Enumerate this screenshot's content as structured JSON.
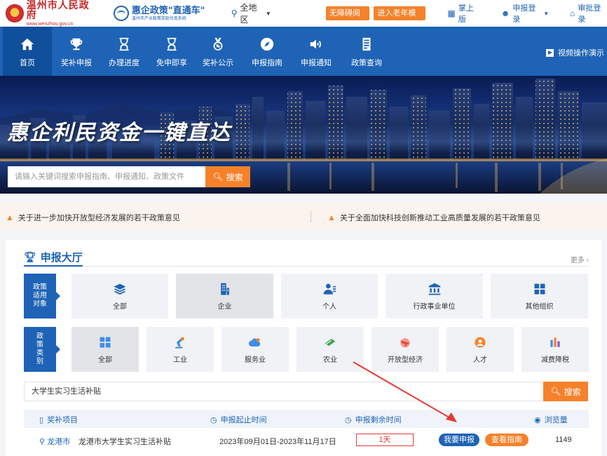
{
  "topbar": {
    "gov_name": "温州市人民政府",
    "gov_url": "www.wenzhou.gov.cn",
    "brand_name": "惠企政策\"直通车\"",
    "brand_sub": "温州市产业政策奖励兑现系统",
    "region": "全地区",
    "accessible_mode": "无障碍阅读",
    "elder_mode": "进入老年模式",
    "mobile": "掌上版",
    "apply_login": "申报登录",
    "review_login": "审批登录"
  },
  "nav": {
    "items": [
      {
        "label": "首页",
        "icon": "home-icon"
      },
      {
        "label": "奖补申报",
        "icon": "trophy-icon"
      },
      {
        "label": "办理进度",
        "icon": "hourglass-icon"
      },
      {
        "label": "免申即享",
        "icon": "hourglass-icon"
      },
      {
        "label": "奖补公示",
        "icon": "medal-icon"
      },
      {
        "label": "申报指南",
        "icon": "compass-icon"
      },
      {
        "label": "申报通知",
        "icon": "speaker-icon"
      },
      {
        "label": "政策查询",
        "icon": "document-icon"
      }
    ],
    "video_demo": "视频操作演示"
  },
  "banner": {
    "slogan": "惠企利民资金一键直达",
    "search_placeholder": "请输入关键词搜索申报指南、申报通知、政策文件",
    "search_button": "搜索"
  },
  "notices": [
    "关于进一步加快开放型经济发展的若干政策意见",
    "关于全面加快科技创新推动工业高质量发展的若干政策意见"
  ],
  "hall": {
    "title": "申报大厅",
    "more": "更多",
    "target_label": "政策适用对象",
    "targets": [
      {
        "label": "全部",
        "icon": "layers-icon"
      },
      {
        "label": "企业",
        "icon": "building-icon",
        "selected": true
      },
      {
        "label": "个人",
        "icon": "person-icon"
      },
      {
        "label": "行政事业单位",
        "icon": "institution-icon"
      },
      {
        "label": "其他组织",
        "icon": "grid-icon"
      }
    ],
    "category_label": "政策类别",
    "categories": [
      {
        "label": "全部",
        "icon": "grid-icon",
        "selected": true
      },
      {
        "label": "工业",
        "icon": "robot-arm-icon"
      },
      {
        "label": "服务业",
        "icon": "cloud-icon"
      },
      {
        "label": "农业",
        "icon": "leaf-icon"
      },
      {
        "label": "开放型经济",
        "icon": "plane-icon"
      },
      {
        "label": "人才",
        "icon": "talent-icon"
      },
      {
        "label": "减费降税",
        "icon": "coins-icon"
      }
    ],
    "search_value": "大学生实习生活补贴",
    "search_button": "搜索",
    "columns": {
      "project": "奖补项目",
      "period": "申报起止时间",
      "remaining": "申报剩余时间",
      "views": "浏览量"
    },
    "rows": [
      {
        "region": "龙港市",
        "project": "龙港市大学生实习生活补贴",
        "period": "2023年09月01日-2023年11月17日",
        "remaining": "1天",
        "apply": "我要申报",
        "guide": "查看指南",
        "views": "1149"
      }
    ]
  },
  "colors": {
    "primary": "#1e63b5",
    "accent": "#f5822a",
    "alert": "#e53935"
  }
}
